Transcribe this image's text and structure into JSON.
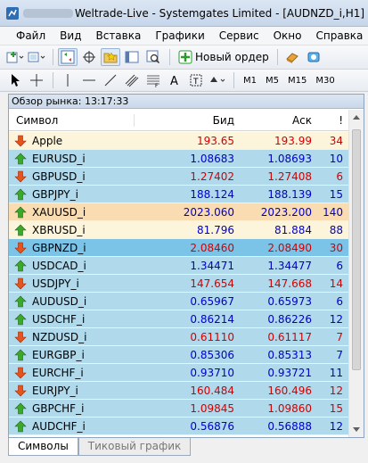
{
  "window": {
    "title": "Weltrade-Live - Systemgates Limited - [AUDNZD_i,H1]"
  },
  "menu": {
    "items": [
      "Файл",
      "Вид",
      "Вставка",
      "Графики",
      "Сервис",
      "Окно",
      "Справка"
    ]
  },
  "toolbar": {
    "new_order_label": "Новый ордер",
    "timeframes": [
      "M1",
      "M5",
      "M15",
      "M30"
    ]
  },
  "panel": {
    "header": "Обзор рынка: 13:17:33",
    "columns": {
      "symbol": "Символ",
      "bid": "Бид",
      "ask": "Аск",
      "spread": "!"
    }
  },
  "rows": [
    {
      "symbol": "Apple",
      "bid": "193.65",
      "ask": "193.99",
      "spread": "34",
      "dir": "down",
      "bg": "cream",
      "color": "red"
    },
    {
      "symbol": "EURUSD_i",
      "bid": "1.08683",
      "ask": "1.08693",
      "spread": "10",
      "dir": "up",
      "bg": "blue",
      "color": "blue"
    },
    {
      "symbol": "GBPUSD_i",
      "bid": "1.27402",
      "ask": "1.27408",
      "spread": "6",
      "dir": "down",
      "bg": "blue",
      "color": "red"
    },
    {
      "symbol": "GBPJPY_i",
      "bid": "188.124",
      "ask": "188.139",
      "spread": "15",
      "dir": "up",
      "bg": "blue",
      "color": "blue"
    },
    {
      "symbol": "XAUUSD_i",
      "bid": "2023.060",
      "ask": "2023.200",
      "spread": "140",
      "dir": "up",
      "bg": "tan",
      "color": "blue"
    },
    {
      "symbol": "XBRUSD_i",
      "bid": "81.796",
      "ask": "81.884",
      "spread": "88",
      "dir": "up",
      "bg": "cream",
      "color": "blue"
    },
    {
      "symbol": "GBPNZD_i",
      "bid": "2.08460",
      "ask": "2.08490",
      "spread": "30",
      "dir": "down",
      "bg": "selected",
      "color": "red"
    },
    {
      "symbol": "USDCAD_i",
      "bid": "1.34471",
      "ask": "1.34477",
      "spread": "6",
      "dir": "up",
      "bg": "blue",
      "color": "blue"
    },
    {
      "symbol": "USDJPY_i",
      "bid": "147.654",
      "ask": "147.668",
      "spread": "14",
      "dir": "down",
      "bg": "blue",
      "color": "red"
    },
    {
      "symbol": "AUDUSD_i",
      "bid": "0.65967",
      "ask": "0.65973",
      "spread": "6",
      "dir": "up",
      "bg": "blue",
      "color": "blue"
    },
    {
      "symbol": "USDCHF_i",
      "bid": "0.86214",
      "ask": "0.86226",
      "spread": "12",
      "dir": "up",
      "bg": "blue",
      "color": "blue"
    },
    {
      "symbol": "NZDUSD_i",
      "bid": "0.61110",
      "ask": "0.61117",
      "spread": "7",
      "dir": "down",
      "bg": "blue",
      "color": "red"
    },
    {
      "symbol": "EURGBP_i",
      "bid": "0.85306",
      "ask": "0.85313",
      "spread": "7",
      "dir": "up",
      "bg": "blue",
      "color": "blue"
    },
    {
      "symbol": "EURCHF_i",
      "bid": "0.93710",
      "ask": "0.93721",
      "spread": "11",
      "dir": "down",
      "bg": "blue",
      "color": "blue"
    },
    {
      "symbol": "EURJPY_i",
      "bid": "160.484",
      "ask": "160.496",
      "spread": "12",
      "dir": "down",
      "bg": "blue",
      "color": "red"
    },
    {
      "symbol": "GBPCHF_i",
      "bid": "1.09845",
      "ask": "1.09860",
      "spread": "15",
      "dir": "up",
      "bg": "blue",
      "color": "red"
    },
    {
      "symbol": "AUDCHF_i",
      "bid": "0.56876",
      "ask": "0.56888",
      "spread": "12",
      "dir": "up",
      "bg": "blue",
      "color": "blue"
    }
  ],
  "tabs": [
    "Символы",
    "Тиковый график"
  ],
  "colors": {
    "up_arrow": "#3aa829",
    "down_arrow": "#e4541c",
    "bid_ask_up": "#0000c8",
    "bid_ask_down": "#d40000"
  }
}
